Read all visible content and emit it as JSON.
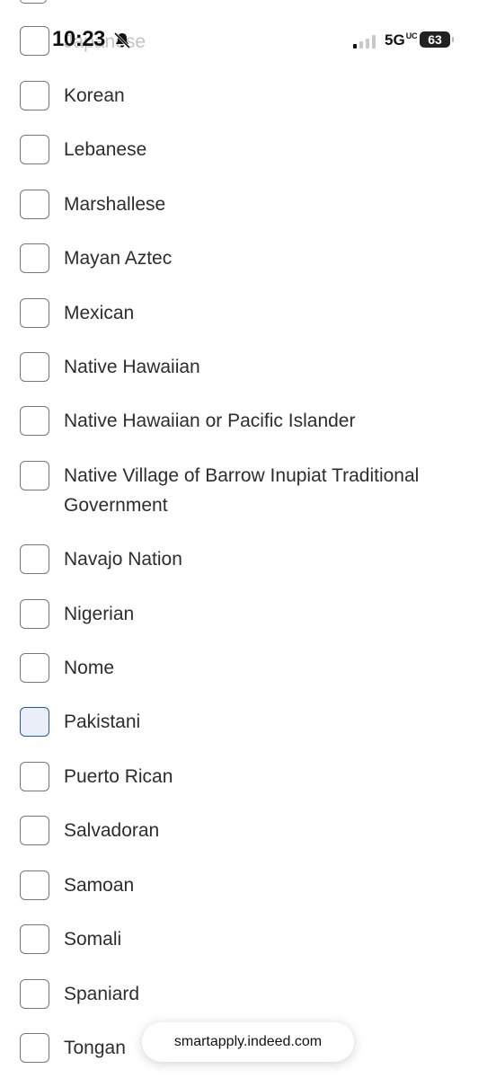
{
  "status_bar": {
    "time": "10:23",
    "network": "5G",
    "network_suffix": "UC",
    "battery": "63"
  },
  "options": {
    "partial": "Japanese",
    "items": [
      {
        "label": "Korean"
      },
      {
        "label": "Lebanese"
      },
      {
        "label": "Marshallese"
      },
      {
        "label": "Mayan Aztec"
      },
      {
        "label": "Mexican"
      },
      {
        "label": "Native Hawaiian"
      },
      {
        "label": "Native Hawaiian or Pacific Islander"
      },
      {
        "label": "Native Village of Barrow Inupiat Traditional Government"
      },
      {
        "label": "Navajo Nation"
      },
      {
        "label": "Nigerian"
      },
      {
        "label": "Nome"
      },
      {
        "label": "Pakistani"
      },
      {
        "label": "Puerto Rican"
      },
      {
        "label": "Salvadoran"
      },
      {
        "label": "Samoan"
      },
      {
        "label": "Somali"
      },
      {
        "label": "Spaniard"
      },
      {
        "label": "Tongan"
      }
    ]
  },
  "browser": {
    "url": "smartapply.indeed.com"
  }
}
